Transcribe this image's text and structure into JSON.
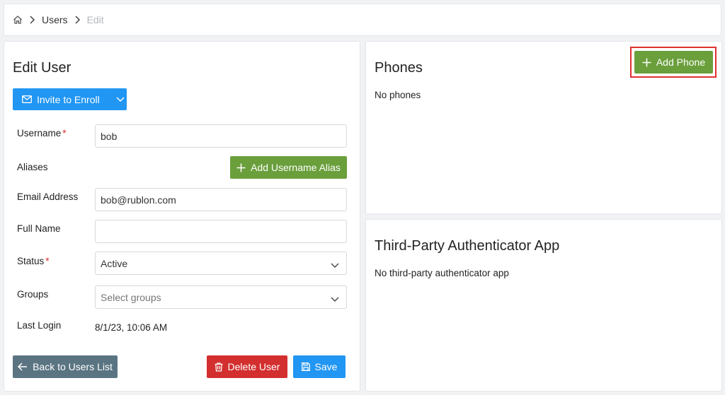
{
  "breadcrumb": {
    "home_icon": "home-icon",
    "users": "Users",
    "current": "Edit"
  },
  "edit_user": {
    "title": "Edit User",
    "invite_button": "Invite to Enroll",
    "fields": {
      "username_label": "Username",
      "username_value": "bob",
      "aliases_label": "Aliases",
      "add_alias_button": "Add Username Alias",
      "email_label": "Email Address",
      "email_value": "bob@rublon.com",
      "fullname_label": "Full Name",
      "fullname_value": "",
      "status_label": "Status",
      "status_value": "Active",
      "groups_label": "Groups",
      "groups_placeholder": "Select groups",
      "last_login_label": "Last Login",
      "last_login_value": "8/1/23, 10:06 AM"
    },
    "required_mark": "*",
    "back_button": "Back to Users List",
    "delete_button": "Delete User",
    "save_button": "Save"
  },
  "phones": {
    "title": "Phones",
    "add_button": "Add Phone",
    "empty_text": "No phones"
  },
  "third_party": {
    "title": "Third-Party Authenticator App",
    "empty_text": "No third-party authenticator app"
  },
  "colors": {
    "primary": "#2196f3",
    "success": "#6a9f3c",
    "danger": "#d32f2f",
    "secondary": "#5a7482",
    "highlight": "#e03030",
    "required": "#e02424"
  }
}
